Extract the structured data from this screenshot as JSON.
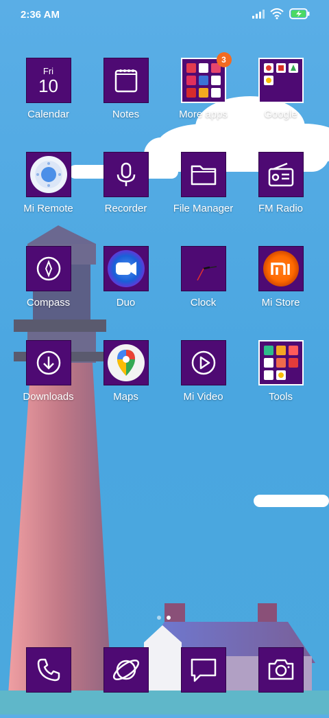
{
  "status_bar": {
    "time": "2:36 AM"
  },
  "calendar": {
    "day": "Fri",
    "date": "10"
  },
  "apps": [
    {
      "label": "Calendar"
    },
    {
      "label": "Notes"
    },
    {
      "label": "More apps",
      "badge": "3"
    },
    {
      "label": "Google"
    },
    {
      "label": "Mi Remote"
    },
    {
      "label": "Recorder"
    },
    {
      "label": "File Manager"
    },
    {
      "label": "FM Radio"
    },
    {
      "label": "Compass"
    },
    {
      "label": "Duo"
    },
    {
      "label": "Clock"
    },
    {
      "label": "Mi Store"
    },
    {
      "label": "Downloads"
    },
    {
      "label": "Maps"
    },
    {
      "label": "Mi Video"
    },
    {
      "label": "Tools"
    }
  ],
  "dock": [
    {
      "icon": "phone-icon"
    },
    {
      "icon": "browser-icon"
    },
    {
      "icon": "messages-icon"
    },
    {
      "icon": "camera-icon"
    }
  ],
  "page_indicator": {
    "pages": 2,
    "active": 1
  },
  "colors": {
    "tile": "#4e0a73",
    "badge": "#f26b22",
    "sky": "#5aaee6"
  }
}
